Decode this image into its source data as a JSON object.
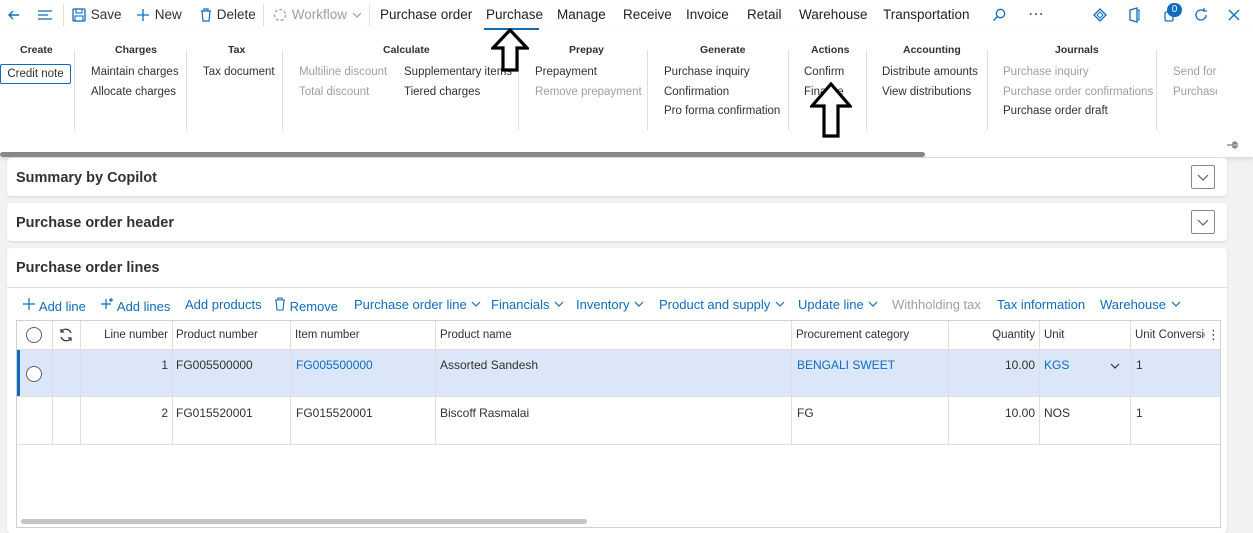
{
  "toolbar": {
    "save": "Save",
    "new": "New",
    "delete": "Delete",
    "workflow": "Workflow",
    "notification_count": "0"
  },
  "tabs": [
    "Purchase order",
    "Purchase",
    "Manage",
    "Receive",
    "Invoice",
    "Retail",
    "Warehouse",
    "Transportation"
  ],
  "active_tab": "Purchase",
  "ribbon": {
    "create": {
      "title": "Create",
      "items": [
        "Credit note"
      ]
    },
    "charges": {
      "title": "Charges",
      "items": [
        "Maintain charges",
        "Allocate charges"
      ]
    },
    "tax": {
      "title": "Tax",
      "items": [
        "Tax document"
      ]
    },
    "calculate": {
      "title": "Calculate",
      "items": [
        "Multiline discount",
        "Total discount",
        "Supplementary items",
        "Tiered charges"
      ]
    },
    "prepay": {
      "title": "Prepay",
      "items": [
        "Prepayment",
        "Remove prepayment"
      ]
    },
    "generate": {
      "title": "Generate",
      "items": [
        "Purchase inquiry",
        "Confirmation",
        "Pro forma confirmation"
      ]
    },
    "actions": {
      "title": "Actions",
      "items": [
        "Confirm",
        "Finalize"
      ]
    },
    "accounting": {
      "title": "Accounting",
      "items": [
        "Distribute amounts",
        "View distributions"
      ]
    },
    "journals": {
      "title": "Journals",
      "items": [
        "Purchase inquiry",
        "Purchase order confirmations",
        "Purchase order draft"
      ]
    },
    "overflow": {
      "items": [
        "Send for",
        "Purchase"
      ]
    }
  },
  "sections": {
    "copilot": "Summary by Copilot",
    "header": "Purchase order header",
    "lines": "Purchase order lines"
  },
  "lines_toolbar": [
    "Add line",
    "Add lines",
    "Add products",
    "Remove",
    "Purchase order line",
    "Financials",
    "Inventory",
    "Product and supply",
    "Update line",
    "Withholding tax",
    "Tax information",
    "Warehouse"
  ],
  "grid": {
    "columns": [
      "Line number",
      "Product number",
      "Item number",
      "Product name",
      "Procurement category",
      "Quantity",
      "Unit",
      "Unit Conversio"
    ],
    "rows": [
      {
        "line": "1",
        "product_number": "FG005500000",
        "item_number": "FG005500000",
        "product_name": "Assorted Sandesh",
        "category": "BENGALI SWEET",
        "quantity": "10.00",
        "unit": "KGS",
        "conversion": "1"
      },
      {
        "line": "2",
        "product_number": "FG015520001",
        "item_number": "FG015520001",
        "product_name": "Biscoff Rasmalai",
        "category": "FG",
        "quantity": "10.00",
        "unit": "NOS",
        "conversion": "1"
      }
    ]
  },
  "colors": {
    "accent": "#0f6cbd",
    "selected_row": "#dbe6f8",
    "disabled": "#a19f9d"
  }
}
